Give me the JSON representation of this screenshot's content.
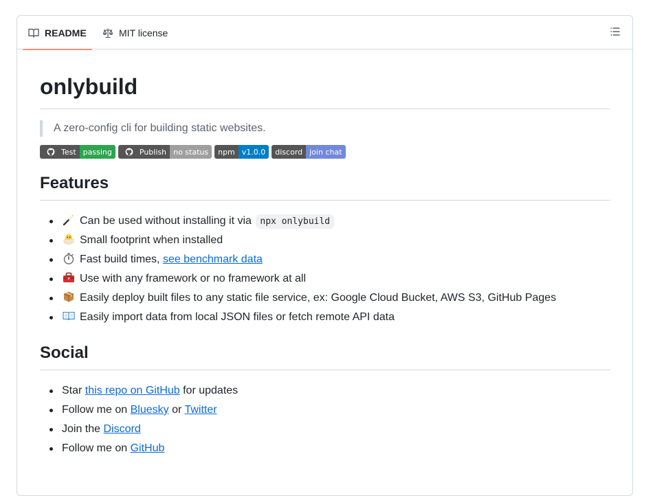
{
  "tabs": {
    "readme_label": "README",
    "license_label": "MIT license"
  },
  "readme": {
    "title": "onlybuild",
    "tagline": "A zero-config cli for building static websites.",
    "badges": [
      {
        "left": "Test",
        "right": "passing",
        "color": "#2ea44f",
        "github": true
      },
      {
        "left": "Publish",
        "right": "no status",
        "color": "#9f9f9f",
        "github": true
      },
      {
        "left": "npm",
        "right": "v1.0.0",
        "color": "#007ec6",
        "github": false
      },
      {
        "left": "discord",
        "right": "join chat",
        "color": "#7289da",
        "github": false
      }
    ],
    "features_heading": "Features",
    "features": [
      {
        "icon": "magic-wand-icon",
        "pre": "Can be used without installing it via",
        "code": "npx onlybuild"
      },
      {
        "icon": "hatching-chick-icon",
        "pre": "Small footprint when installed"
      },
      {
        "icon": "stopwatch-icon",
        "pre": "Fast build times,",
        "link": "see benchmark data"
      },
      {
        "icon": "toolbox-icon",
        "pre": "Use with any framework or no framework at all"
      },
      {
        "icon": "package-icon",
        "pre": "Easily deploy built files to any static file service, ex: Google Cloud Bucket, AWS S3, GitHub Pages"
      },
      {
        "icon": "open-book-icon",
        "pre": "Easily import data from local JSON files or fetch remote API data"
      }
    ],
    "social_heading": "Social",
    "social": [
      {
        "pre": "Star",
        "link1": "this repo on GitHub",
        "mid": "for updates"
      },
      {
        "pre": "Follow me on",
        "link1": "Bluesky",
        "mid": "or",
        "link2": "Twitter"
      },
      {
        "pre": "Join the",
        "link1": "Discord"
      },
      {
        "pre": "Follow me on",
        "link1": "GitHub"
      }
    ]
  }
}
